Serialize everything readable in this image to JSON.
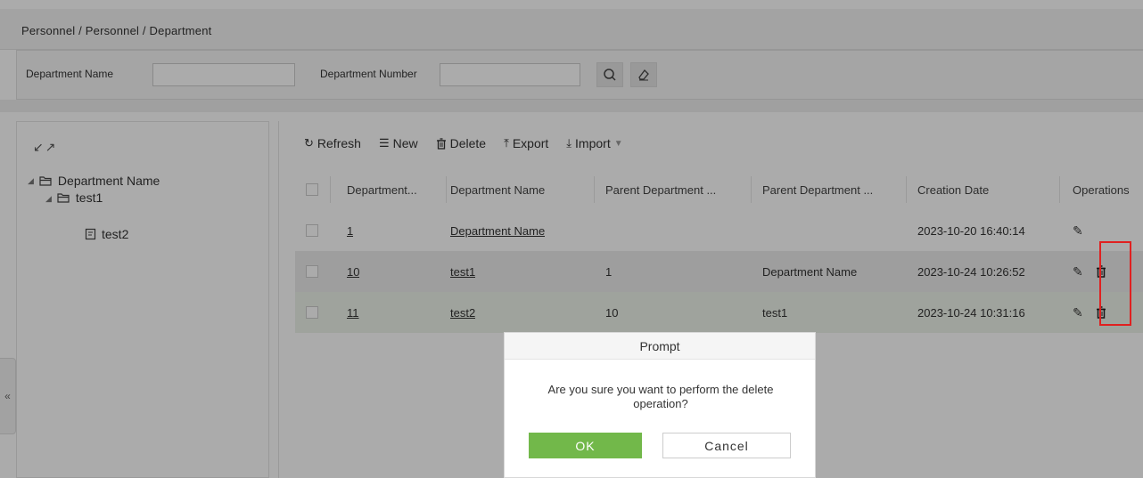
{
  "breadcrumb": "Personnel / Personnel / Department",
  "search": {
    "dept_name_label": "Department Name",
    "dept_name_value": "",
    "dept_number_label": "Department Number",
    "dept_number_value": "",
    "search_icon": "search-icon",
    "clear_icon": "eraser-icon"
  },
  "tree": {
    "expand_icons": "↙↗",
    "nodes": [
      {
        "label": "Department Name",
        "icon": "folder-open-icon",
        "expanded": true
      },
      {
        "label": "test1",
        "icon": "folder-open-icon",
        "expanded": true
      },
      {
        "label": "test2",
        "icon": "document-icon"
      }
    ]
  },
  "collapse_glyph": "«",
  "toolbar": {
    "refresh": "Refresh",
    "new": "New",
    "delete": "Delete",
    "export": "Export",
    "import": "Import"
  },
  "table": {
    "columns": [
      "Department...",
      "Department Name",
      "Parent Department ...",
      "Parent Department ...",
      "Creation Date",
      "Operations"
    ],
    "rows": [
      {
        "number": "1",
        "name": "Department Name",
        "parent_number": "",
        "parent_name": "",
        "created": "2023-10-20 16:40:14",
        "deletable": false
      },
      {
        "number": "10",
        "name": "test1",
        "parent_number": "1",
        "parent_name": "Department Name",
        "created": "2023-10-24 10:26:52",
        "deletable": true
      },
      {
        "number": "11",
        "name": "test2",
        "parent_number": "10",
        "parent_name": "test1",
        "created": "2023-10-24 10:31:16",
        "deletable": true
      }
    ]
  },
  "dialog": {
    "title": "Prompt",
    "message": "Are you sure you want to perform the delete operation?",
    "ok_label": "OK",
    "cancel_label": "Cancel"
  },
  "colors": {
    "ok_button": "#72b84a",
    "highlight_box": "#e02020"
  }
}
